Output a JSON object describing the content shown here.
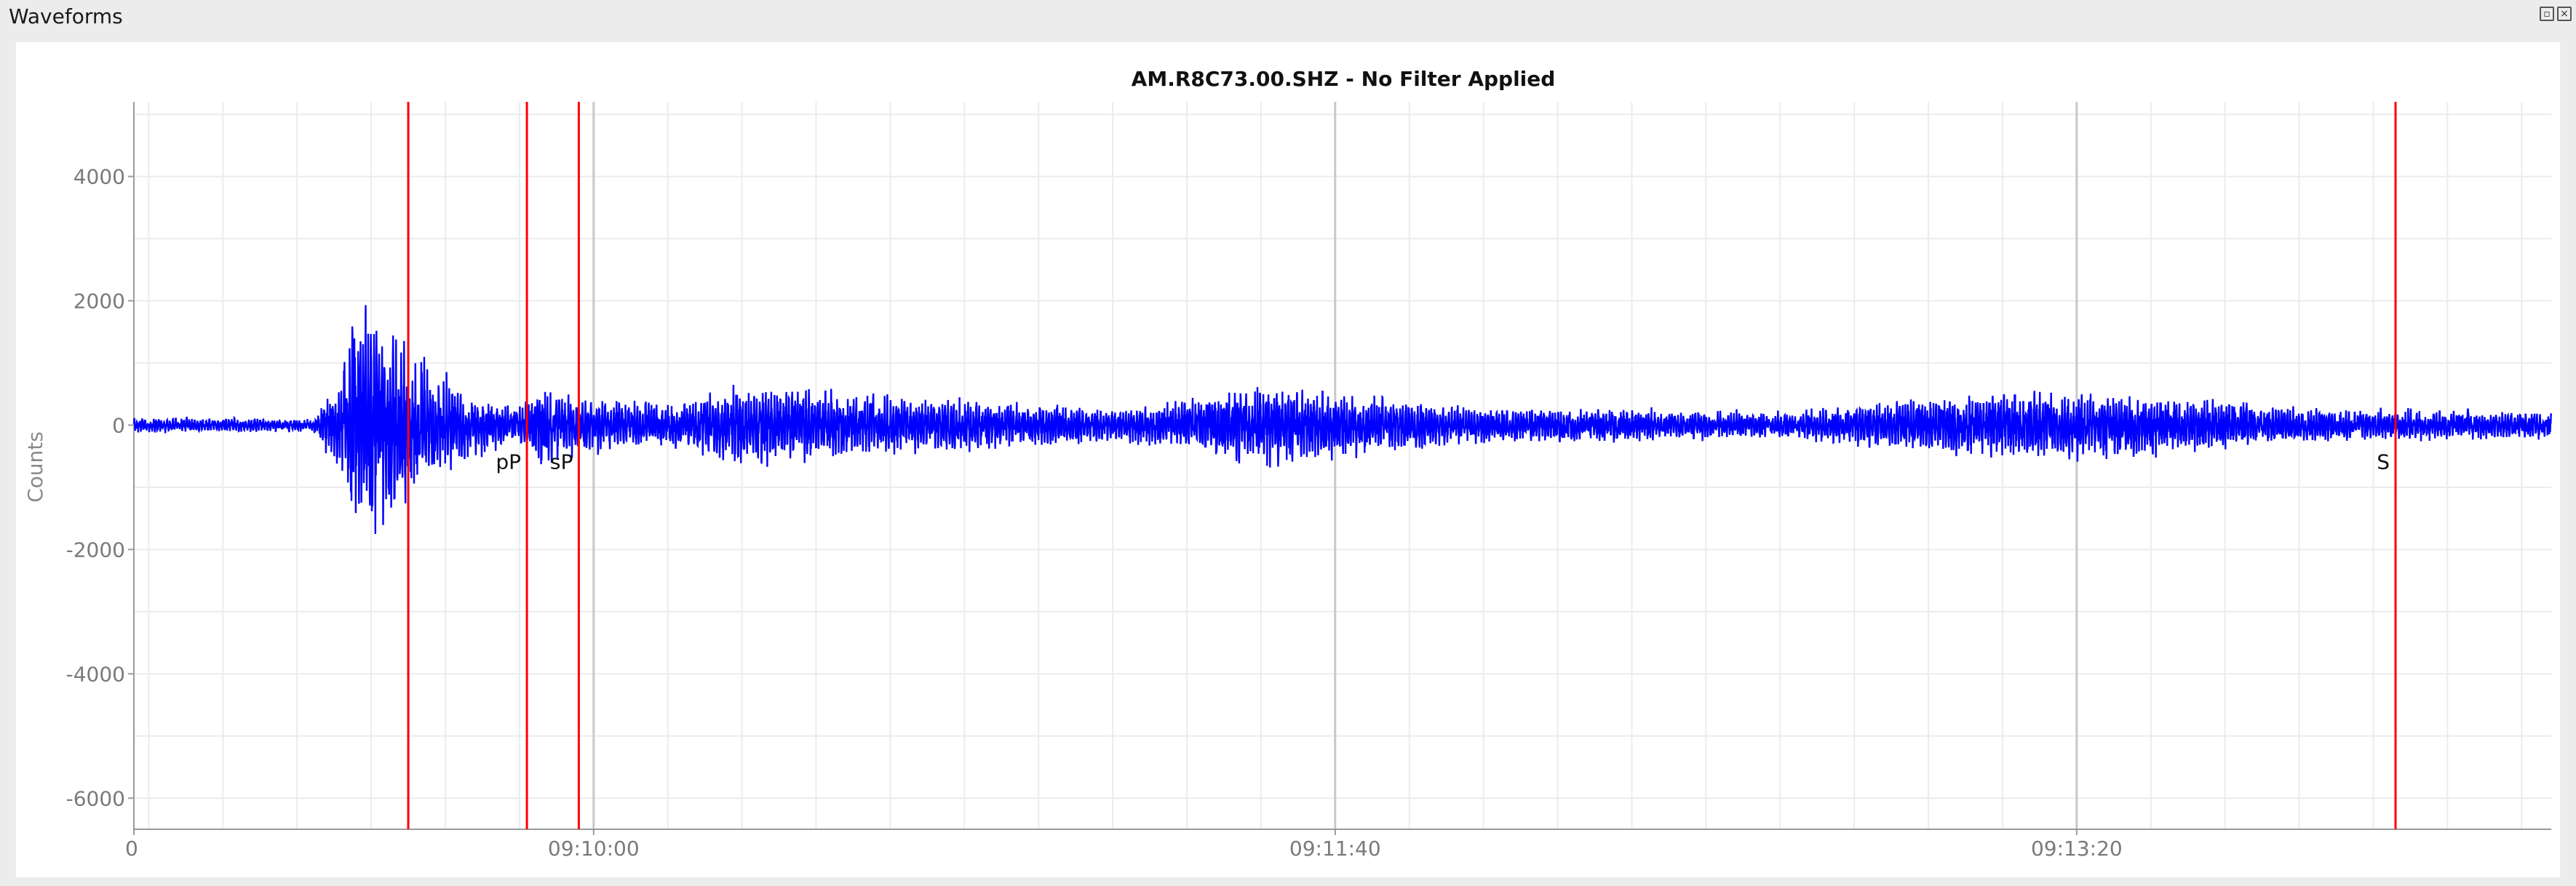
{
  "window": {
    "title": "Waveforms",
    "float_icon": "float-window-icon",
    "close_icon": "close-icon"
  },
  "chart_data": {
    "type": "line",
    "title": "AM.R8C73.00.SHZ - No Filter Applied",
    "xlabel": "",
    "ylabel": "Counts",
    "ylim": [
      -6500,
      5200
    ],
    "y_ticks": [
      4000,
      2000,
      0,
      -2000,
      -4000,
      -6000
    ],
    "y_tick_labels": [
      "4000",
      "2000",
      "0",
      "-2000",
      "-4000",
      "-6000"
    ],
    "x_time_range": [
      "09:08:58",
      "09:14:24"
    ],
    "x_ticks": [
      {
        "time": "09:08:58",
        "label": "0"
      },
      {
        "time": "09:10:00",
        "label": "09:10:00"
      },
      {
        "time": "09:11:40",
        "label": "09:11:40"
      },
      {
        "time": "09:13:20",
        "label": "09:13:20"
      }
    ],
    "grid": true,
    "series": [
      {
        "color": "#0000ff",
        "envelope": [
          {
            "time": "09:08:58",
            "half_amplitude": 150
          },
          {
            "time": "09:09:22",
            "half_amplitude": 120
          },
          {
            "time": "09:09:26",
            "half_amplitude": 900
          },
          {
            "time": "09:09:28",
            "half_amplitude": 2600
          },
          {
            "time": "09:09:31",
            "half_amplitude": 1900
          },
          {
            "time": "09:09:35",
            "half_amplitude": 1500
          },
          {
            "time": "09:09:42",
            "half_amplitude": 700
          },
          {
            "time": "09:09:49",
            "half_amplitude": 350
          },
          {
            "time": "09:09:53",
            "half_amplitude": 750
          },
          {
            "time": "09:09:57",
            "half_amplitude": 550
          },
          {
            "time": "09:10:10",
            "half_amplitude": 400
          },
          {
            "time": "09:10:20",
            "half_amplitude": 750
          },
          {
            "time": "09:10:42",
            "half_amplitude": 550
          },
          {
            "time": "09:11:10",
            "half_amplitude": 300
          },
          {
            "time": "09:11:30",
            "half_amplitude": 750
          },
          {
            "time": "09:11:40",
            "half_amplitude": 600
          },
          {
            "time": "09:12:00",
            "half_amplitude": 350
          },
          {
            "time": "09:12:40",
            "half_amplitude": 250
          },
          {
            "time": "09:13:12",
            "half_amplitude": 700
          },
          {
            "time": "09:13:30",
            "half_amplitude": 600
          },
          {
            "time": "09:13:50",
            "half_amplitude": 320
          },
          {
            "time": "09:14:24",
            "half_amplitude": 280
          }
        ]
      }
    ],
    "phase_picks": [
      {
        "label": "P",
        "time": "09:09:35",
        "label_visible": false
      },
      {
        "label": "pP",
        "time": "09:09:51"
      },
      {
        "label": "sP",
        "time": "09:09:58"
      },
      {
        "label": "S",
        "time": "09:14:03"
      }
    ],
    "pick_color": "#ff0000"
  }
}
